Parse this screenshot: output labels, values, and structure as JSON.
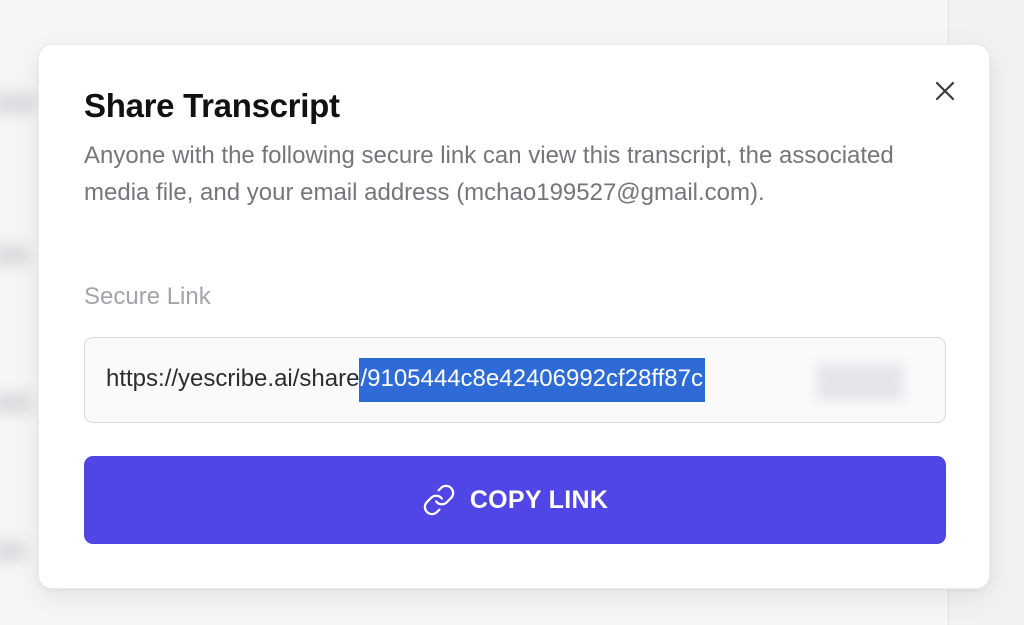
{
  "modal": {
    "title": "Share Transcript",
    "description": "Anyone with the following secure link can view this transcript, the associated media file, and your email address (mchao199527@gmail.com).",
    "close_icon": "close-icon",
    "secure_link_label": "Secure Link",
    "link": {
      "prefix": "https://yescribe.ai/share",
      "selected": "/9105444c8e42406992cf28ff87c"
    },
    "copy_button": {
      "icon": "link-icon",
      "label": "COPY LINK"
    }
  },
  "colors": {
    "accent": "#4f46e5",
    "selection": "#2f6bd6",
    "text_primary": "#111113",
    "text_muted": "#74767c"
  }
}
